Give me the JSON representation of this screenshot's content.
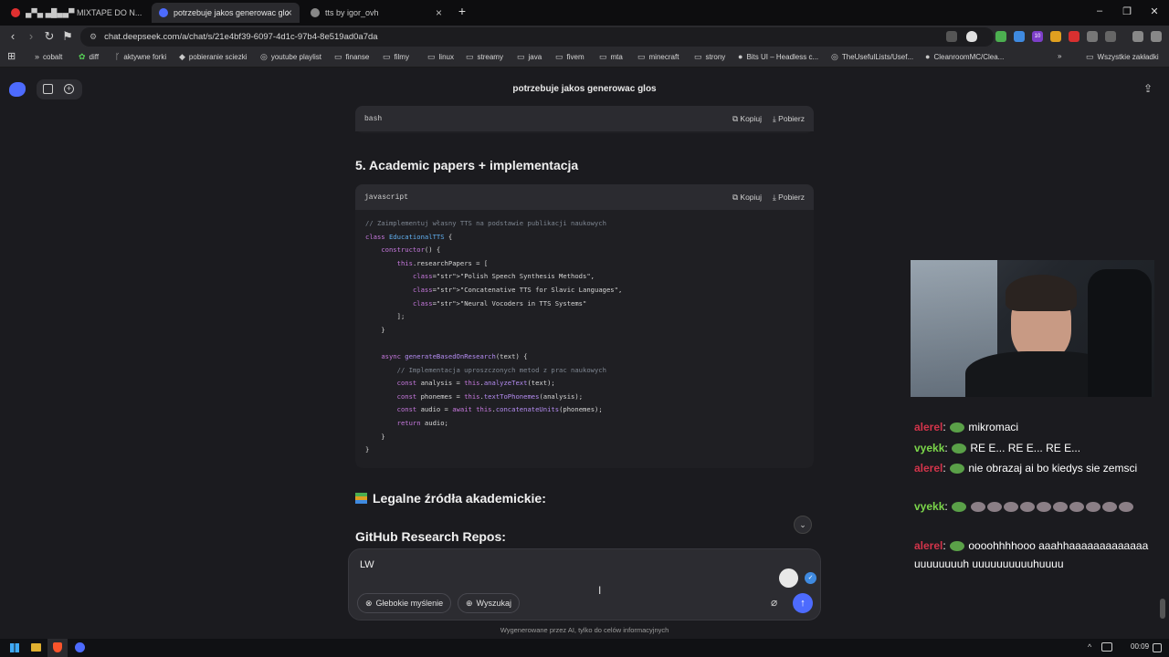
{
  "browser": {
    "tabs": [
      {
        "label": "▄▀▄ ▄█▄▄▀ MIXTAPE DO N...",
        "active": false
      },
      {
        "label": "potrzebuje jakos generowac glo",
        "active": true
      },
      {
        "label": "tts by igor_ovh",
        "active": false
      }
    ],
    "url": "chat.deepseek.com/a/chat/s/21e4bf39-6097-4d1c-97b4-8e519ad0a7da",
    "bookmarks": [
      "cobalt",
      "diff",
      "aktywne forki",
      "pobieranie sciezki",
      "youtube playlist",
      "finanse",
      "filmy",
      "linux",
      "streamy",
      "java",
      "fivem",
      "mta",
      "minecraft",
      "strony",
      "Bits UI – Headless c...",
      "TheUsefulLists/Usef...",
      "CleanroomMC/Clea..."
    ],
    "all_bookmarks": "Wszystkie zakładki",
    "ext_badge": "10"
  },
  "page": {
    "title": "potrzebuje jakos generowac glos",
    "block1": {
      "lang": "bash",
      "copy": "Kopiuj",
      "download": "Pobierz"
    },
    "section5": "5. Academic papers + implementacja",
    "block2": {
      "lang": "javascript",
      "copy": "Kopiuj",
      "download": "Pobierz",
      "lines": [
        "// Zaimplementuj własny TTS na podstawie publikacji naukowych",
        "class EducationalTTS {",
        "    constructor() {",
        "        this.researchPapers = [",
        "            \"Polish Speech Synthesis Methods\",",
        "            \"Concatenative TTS for Slavic Languages\",",
        "            \"Neural Vocoders in TTS Systems\"",
        "        ];",
        "    }",
        "",
        "    async generateBasedOnResearch(text) {",
        "        // Implementacja uproszczonych metod z prac naukowych",
        "        const analysis = this.analyzeText(text);",
        "        const phonemes = this.textToPhonemes(analysis);",
        "        const audio = await this.concatenateUnits(phonemes);",
        "        return audio;",
        "    }",
        "}"
      ]
    },
    "legal_heading": "Legalne źródła akademickie:",
    "github_heading": "GitHub Research Repos:",
    "composer": {
      "value": "LW",
      "deep_think": "Głebokie myślenie",
      "search": "Wyszukaj"
    },
    "footer": "Wygenerowane przez AI, tylko do celów informacyjnych"
  },
  "chat": [
    {
      "user": "alerel",
      "color": "#d2344a",
      "message": "mikromaci"
    },
    {
      "user": "vyekk",
      "color": "#7bd64a",
      "message": "RE E... RE E... RE E..."
    },
    {
      "user": "alerel",
      "color": "#d2344a",
      "message": "nie obrazaj ai bo kiedys sie zemsci"
    },
    {
      "user": "vyekk",
      "color": "#7bd64a",
      "message": ""
    },
    {
      "user": "alerel",
      "color": "#d2344a",
      "message": "oooohhhhooo aaahhaaaaaaaaaaaaa uuuuuuuuh uuuuuuuuuuhuuuu"
    }
  ],
  "taskbar": {
    "time": "00:09"
  }
}
